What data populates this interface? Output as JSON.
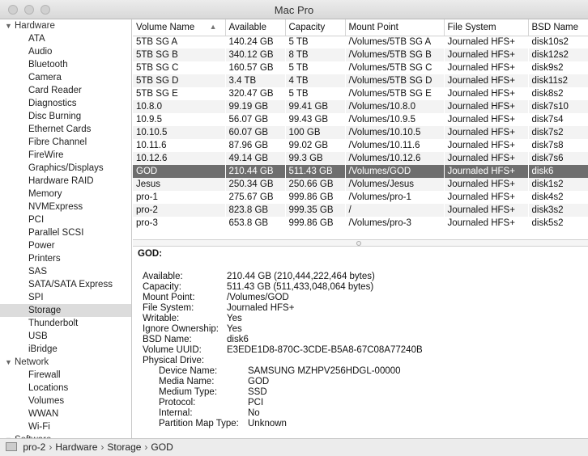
{
  "window": {
    "title": "Mac Pro"
  },
  "sidebar": {
    "sections": [
      {
        "label": "Hardware",
        "items": [
          "ATA",
          "Audio",
          "Bluetooth",
          "Camera",
          "Card Reader",
          "Diagnostics",
          "Disc Burning",
          "Ethernet Cards",
          "Fibre Channel",
          "FireWire",
          "Graphics/Displays",
          "Hardware RAID",
          "Memory",
          "NVMExpress",
          "PCI",
          "Parallel SCSI",
          "Power",
          "Printers",
          "SAS",
          "SATA/SATA Express",
          "SPI",
          "Storage",
          "Thunderbolt",
          "USB",
          "iBridge"
        ]
      },
      {
        "label": "Network",
        "items": [
          "Firewall",
          "Locations",
          "Volumes",
          "WWAN",
          "Wi-Fi"
        ]
      },
      {
        "label": "Software",
        "items": []
      }
    ],
    "selected": "Storage"
  },
  "table": {
    "columns": [
      "Volume Name",
      "Available",
      "Capacity",
      "Mount Point",
      "File System",
      "BSD Name"
    ],
    "rows": [
      [
        "5TB SG A",
        "140.24 GB",
        "5 TB",
        "/Volumes/5TB SG A",
        "Journaled HFS+",
        "disk10s2"
      ],
      [
        "5TB SG B",
        "340.12 GB",
        "8 TB",
        "/Volumes/5TB SG B",
        "Journaled HFS+",
        "disk12s2"
      ],
      [
        "5TB SG C",
        "160.57 GB",
        "5 TB",
        "/Volumes/5TB SG C",
        "Journaled HFS+",
        "disk9s2"
      ],
      [
        "5TB SG D",
        "3.4 TB",
        "4 TB",
        "/Volumes/5TB SG D",
        "Journaled HFS+",
        "disk11s2"
      ],
      [
        "5TB SG E",
        "320.47 GB",
        "5 TB",
        "/Volumes/5TB SG E",
        "Journaled HFS+",
        "disk8s2"
      ],
      [
        "10.8.0",
        "99.19 GB",
        "99.41 GB",
        "/Volumes/10.8.0",
        "Journaled HFS+",
        "disk7s10"
      ],
      [
        "10.9.5",
        "56.07 GB",
        "99.43 GB",
        "/Volumes/10.9.5",
        "Journaled HFS+",
        "disk7s4"
      ],
      [
        "10.10.5",
        "60.07 GB",
        "100 GB",
        "/Volumes/10.10.5",
        "Journaled HFS+",
        "disk7s2"
      ],
      [
        "10.11.6",
        "87.96 GB",
        "99.02 GB",
        "/Volumes/10.11.6",
        "Journaled HFS+",
        "disk7s8"
      ],
      [
        "10.12.6",
        "49.14 GB",
        "99.3 GB",
        "/Volumes/10.12.6",
        "Journaled HFS+",
        "disk7s6"
      ],
      [
        "GOD",
        "210.44 GB",
        "511.43 GB",
        "/Volumes/GOD",
        "Journaled HFS+",
        "disk6"
      ],
      [
        "Jesus",
        "250.34 GB",
        "250.66 GB",
        "/Volumes/Jesus",
        "Journaled HFS+",
        "disk1s2"
      ],
      [
        "pro-1",
        "275.67 GB",
        "999.86 GB",
        "/Volumes/pro-1",
        "Journaled HFS+",
        "disk4s2"
      ],
      [
        "pro-2",
        "823.8 GB",
        "999.35 GB",
        "/",
        "Journaled HFS+",
        "disk3s2"
      ],
      [
        "pro-3",
        "653.8 GB",
        "999.86 GB",
        "/Volumes/pro-3",
        "Journaled HFS+",
        "disk5s2"
      ]
    ],
    "selected_index": 10
  },
  "detail": {
    "title": "GOD:",
    "fields": [
      [
        "Available:",
        "210.44 GB (210,444,222,464 bytes)"
      ],
      [
        "Capacity:",
        "511.43 GB (511,433,048,064 bytes)"
      ],
      [
        "Mount Point:",
        "/Volumes/GOD"
      ],
      [
        "File System:",
        "Journaled HFS+"
      ],
      [
        "Writable:",
        "Yes"
      ],
      [
        "Ignore Ownership:",
        "Yes"
      ],
      [
        "BSD Name:",
        "disk6"
      ],
      [
        "Volume UUID:",
        "E3EDE1D8-870C-3CDE-B5A8-67C08A77240B"
      ]
    ],
    "physical_label": "Physical Drive:",
    "physical_fields": [
      [
        "Device Name:",
        "SAMSUNG MZHPV256HDGL-00000"
      ],
      [
        "Media Name:",
        "GOD"
      ],
      [
        "Medium Type:",
        "SSD"
      ],
      [
        "Protocol:",
        "PCI"
      ],
      [
        "Internal:",
        "No"
      ],
      [
        "Partition Map Type:",
        "Unknown"
      ]
    ]
  },
  "pathbar": {
    "items": [
      "pro-2",
      "Hardware",
      "Storage",
      "GOD"
    ],
    "separator": "›"
  }
}
